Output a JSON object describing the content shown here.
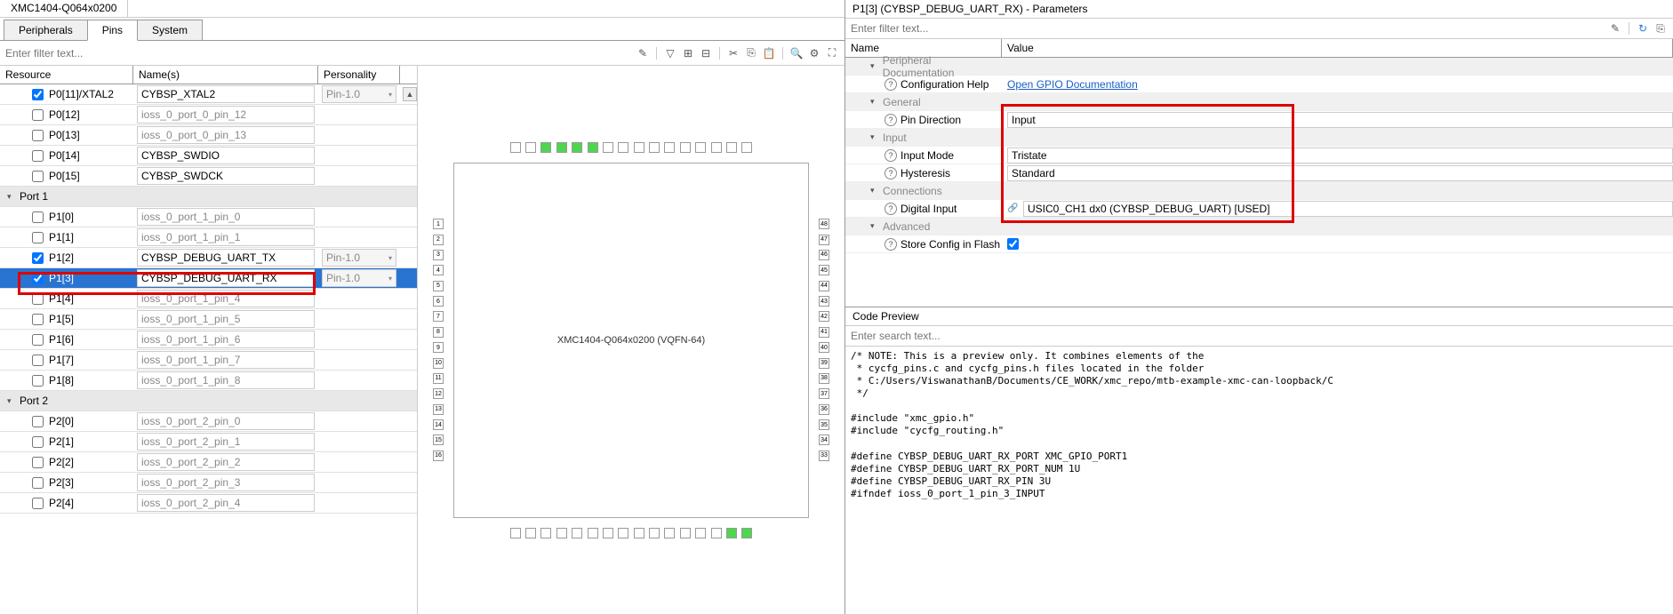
{
  "device_tab": "XMC1404-Q064x0200",
  "tabs": {
    "peripherals": "Peripherals",
    "pins": "Pins",
    "system": "System"
  },
  "filter_placeholder": "Enter filter text...",
  "grid_headers": {
    "resource": "Resource",
    "name": "Name(s)",
    "personality": "Personality"
  },
  "rows": [
    {
      "type": "pin",
      "checked": true,
      "res": "P0[11]/XTAL2",
      "name": "CYBSP_XTAL2",
      "pers": "Pin-1.0",
      "active": true
    },
    {
      "type": "pin",
      "checked": false,
      "res": "P0[12]",
      "name": "ioss_0_port_0_pin_12",
      "pers": "",
      "active": false
    },
    {
      "type": "pin",
      "checked": false,
      "res": "P0[13]",
      "name": "ioss_0_port_0_pin_13",
      "pers": "",
      "active": false
    },
    {
      "type": "pin",
      "checked": false,
      "res": "P0[14]",
      "name": "CYBSP_SWDIO",
      "pers": "",
      "active": true
    },
    {
      "type": "pin",
      "checked": false,
      "res": "P0[15]",
      "name": "CYBSP_SWDCK",
      "pers": "",
      "active": true
    },
    {
      "type": "group",
      "res": "Port 1"
    },
    {
      "type": "pin",
      "checked": false,
      "res": "P1[0]",
      "name": "ioss_0_port_1_pin_0",
      "pers": "",
      "active": false
    },
    {
      "type": "pin",
      "checked": false,
      "res": "P1[1]",
      "name": "ioss_0_port_1_pin_1",
      "pers": "",
      "active": false
    },
    {
      "type": "pin",
      "checked": true,
      "res": "P1[2]",
      "name": "CYBSP_DEBUG_UART_TX",
      "pers": "Pin-1.0",
      "active": true
    },
    {
      "type": "pin",
      "checked": true,
      "res": "P1[3]",
      "name": "CYBSP_DEBUG_UART_RX",
      "pers": "Pin-1.0",
      "active": true,
      "selected": true
    },
    {
      "type": "pin",
      "checked": false,
      "res": "P1[4]",
      "name": "ioss_0_port_1_pin_4",
      "pers": "",
      "active": false
    },
    {
      "type": "pin",
      "checked": false,
      "res": "P1[5]",
      "name": "ioss_0_port_1_pin_5",
      "pers": "",
      "active": false
    },
    {
      "type": "pin",
      "checked": false,
      "res": "P1[6]",
      "name": "ioss_0_port_1_pin_6",
      "pers": "",
      "active": false
    },
    {
      "type": "pin",
      "checked": false,
      "res": "P1[7]",
      "name": "ioss_0_port_1_pin_7",
      "pers": "",
      "active": false
    },
    {
      "type": "pin",
      "checked": false,
      "res": "P1[8]",
      "name": "ioss_0_port_1_pin_8",
      "pers": "",
      "active": false
    },
    {
      "type": "group",
      "res": "Port 2"
    },
    {
      "type": "pin",
      "checked": false,
      "res": "P2[0]",
      "name": "ioss_0_port_2_pin_0",
      "pers": "",
      "active": false
    },
    {
      "type": "pin",
      "checked": false,
      "res": "P2[1]",
      "name": "ioss_0_port_2_pin_1",
      "pers": "",
      "active": false
    },
    {
      "type": "pin",
      "checked": false,
      "res": "P2[2]",
      "name": "ioss_0_port_2_pin_2",
      "pers": "",
      "active": false
    },
    {
      "type": "pin",
      "checked": false,
      "res": "P2[3]",
      "name": "ioss_0_port_2_pin_3",
      "pers": "",
      "active": false
    },
    {
      "type": "pin",
      "checked": false,
      "res": "P2[4]",
      "name": "ioss_0_port_2_pin_4",
      "pers": "",
      "active": false
    }
  ],
  "chip_label": "XMC1404-Q064x0200 (VQFN-64)",
  "param_title": "P1[3] (CYBSP_DEBUG_UART_RX) - Parameters",
  "param_filter_placeholder": "Enter filter text...",
  "param_headers": {
    "name": "Name",
    "value": "Value"
  },
  "params": {
    "doc_group": "Peripheral Documentation",
    "config_help": "Configuration Help",
    "config_help_link": "Open GPIO Documentation",
    "general_group": "General",
    "pin_direction": "Pin Direction",
    "pin_direction_val": "Input",
    "input_group": "Input",
    "input_mode": "Input Mode",
    "input_mode_val": "Tristate",
    "hysteresis": "Hysteresis",
    "hysteresis_val": "Standard",
    "connections_group": "Connections",
    "digital_input": "Digital Input",
    "digital_input_val": "USIC0_CH1 dx0 (CYBSP_DEBUG_UART) [USED]",
    "advanced_group": "Advanced",
    "store_config": "Store Config in Flash"
  },
  "code_preview_title": "Code Preview",
  "code_search_placeholder": "Enter search text...",
  "code_body": "/* NOTE: This is a preview only. It combines elements of the\n * cycfg_pins.c and cycfg_pins.h files located in the folder\n * C:/Users/ViswanathanB/Documents/CE_WORK/xmc_repo/mtb-example-xmc-can-loopback/C\n */\n\n#include \"xmc_gpio.h\"\n#include \"cycfg_routing.h\"\n\n#define CYBSP_DEBUG_UART_RX_PORT XMC_GPIO_PORT1\n#define CYBSP_DEBUG_UART_RX_PORT_NUM 1U\n#define CYBSP_DEBUG_UART_RX_PIN 3U\n#ifndef ioss_0_port_1_pin_3_INPUT"
}
